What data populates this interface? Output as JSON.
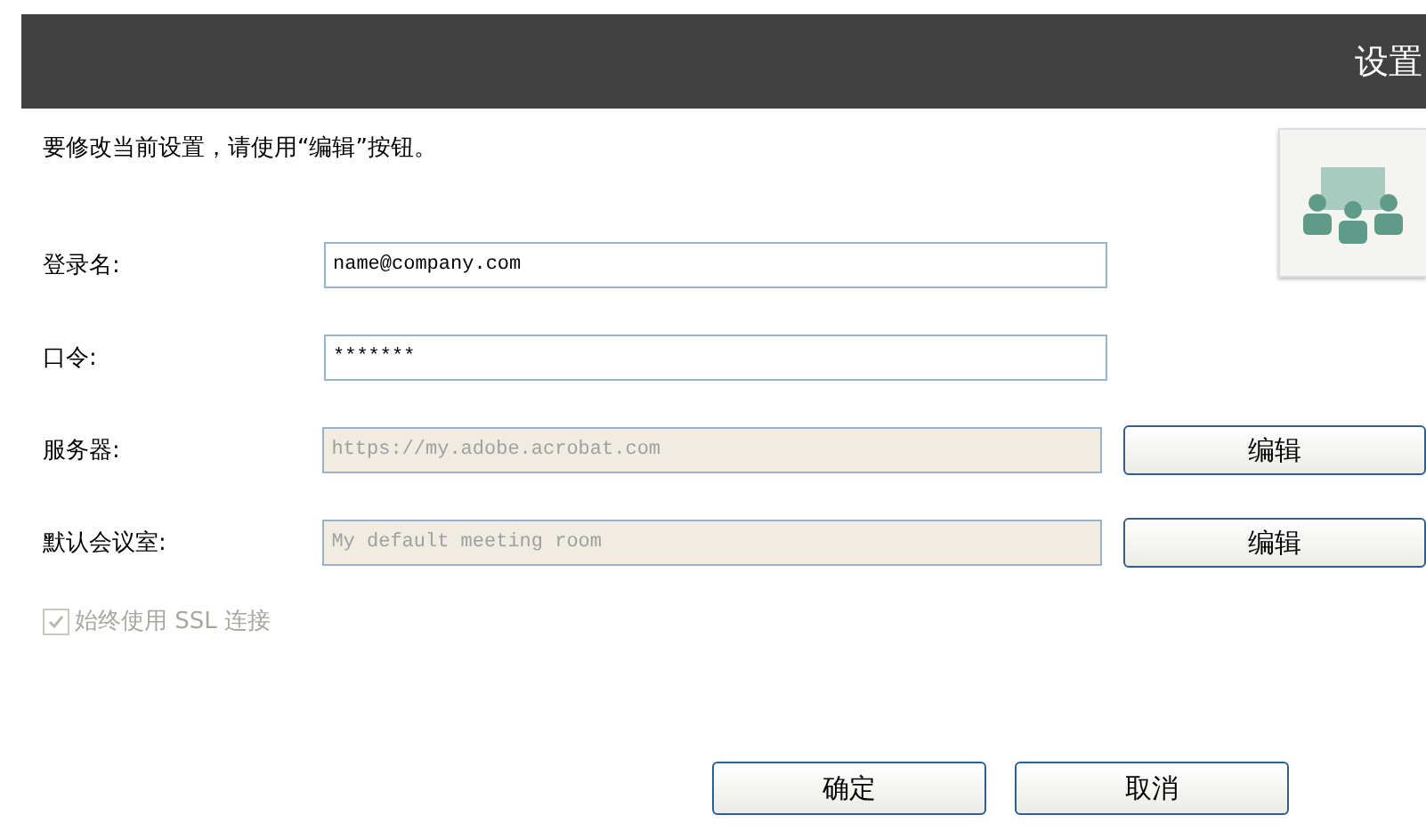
{
  "header": {
    "title": "设置"
  },
  "instruction": "要修改当前设置，请使用“编辑”按钮。",
  "fields": [
    {
      "label": "登录名:",
      "value": "name@company.com",
      "disabled": false
    },
    {
      "label": "口令:",
      "value": "*******",
      "disabled": false
    },
    {
      "label": "服务器:",
      "value": "https://my.adobe.acrobat.com",
      "disabled": true,
      "edit_button": "编辑"
    },
    {
      "label": "默认会议室:",
      "value": "My default meeting room",
      "disabled": true,
      "edit_button": "编辑"
    }
  ],
  "ssl_checkbox": {
    "label": "始终使用 SSL 连接",
    "checked": true,
    "disabled": true
  },
  "buttons": [
    "确定",
    "取消"
  ]
}
